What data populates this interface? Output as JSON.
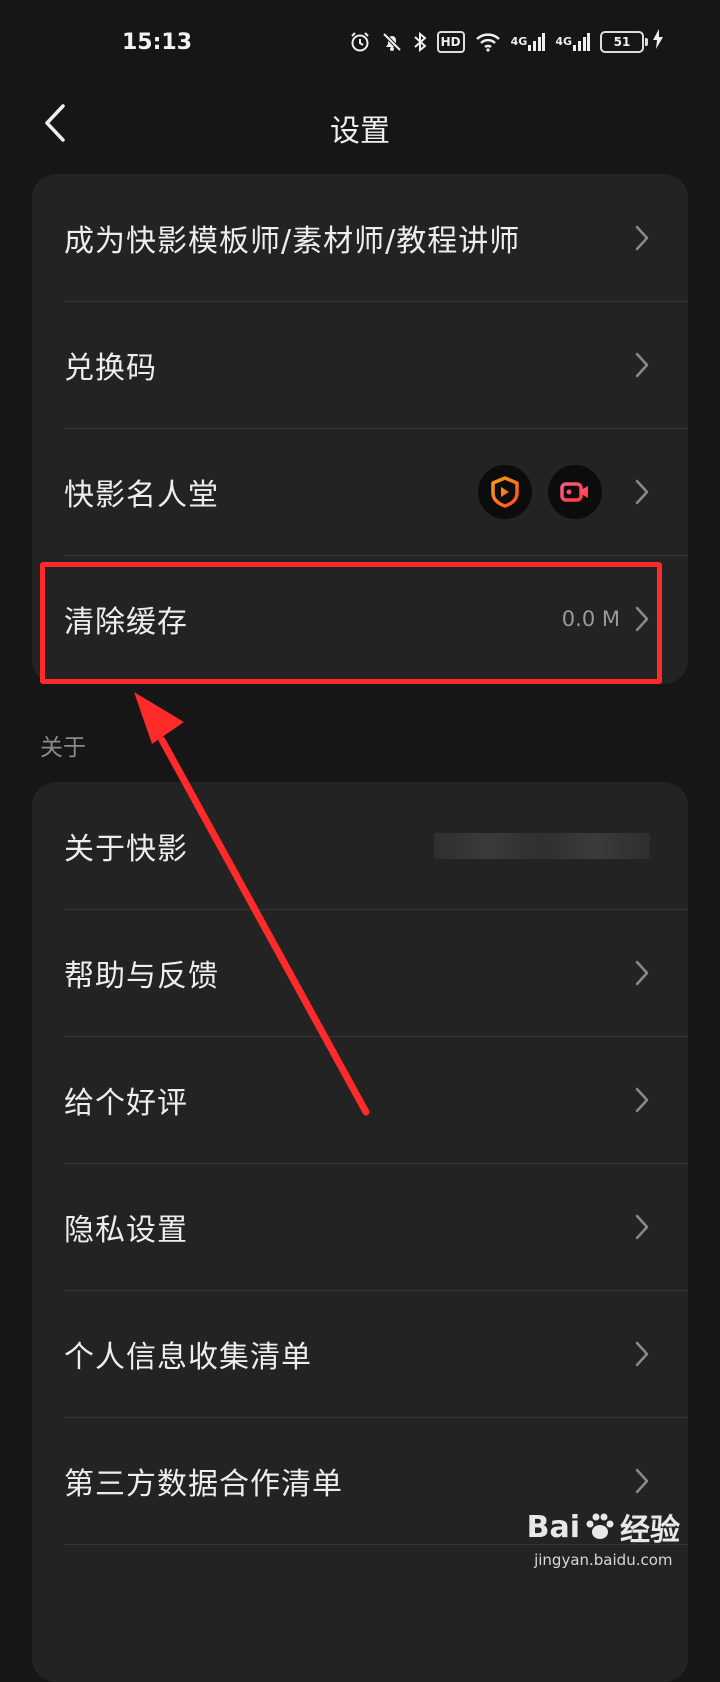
{
  "status_bar": {
    "time": "15:13",
    "icons": [
      "alarm-icon",
      "mute-bell-icon",
      "bluetooth-icon",
      "hd-icon",
      "wifi-icon",
      "signal-4g-icon",
      "signal-4g-icon",
      "battery-icon",
      "charging-icon"
    ],
    "hd_label": "HD",
    "net1": "4G",
    "net2": "4G",
    "battery": "51"
  },
  "header": {
    "title": "设置"
  },
  "group1": {
    "items": [
      {
        "label": "成为快影模板师/素材师/教程讲师"
      },
      {
        "label": "兑换码"
      },
      {
        "label": "快影名人堂",
        "badges": [
          "kuaiying-logo",
          "video-camera-logo"
        ]
      },
      {
        "label": "清除缓存",
        "value": "0.0 M"
      }
    ]
  },
  "section_about": {
    "label": "关于"
  },
  "group2": {
    "items": [
      {
        "label": "关于快影",
        "value_blurred": true
      },
      {
        "label": "帮助与反馈"
      },
      {
        "label": "给个好评"
      },
      {
        "label": "隐私设置"
      },
      {
        "label": "个人信息收集清单"
      },
      {
        "label": "第三方数据合作清单"
      }
    ]
  },
  "annotation": {
    "color": "#ff2a2a"
  },
  "watermark": {
    "text": "经验",
    "logo_text": "Bai",
    "sub": "jingyan.baidu.com"
  }
}
